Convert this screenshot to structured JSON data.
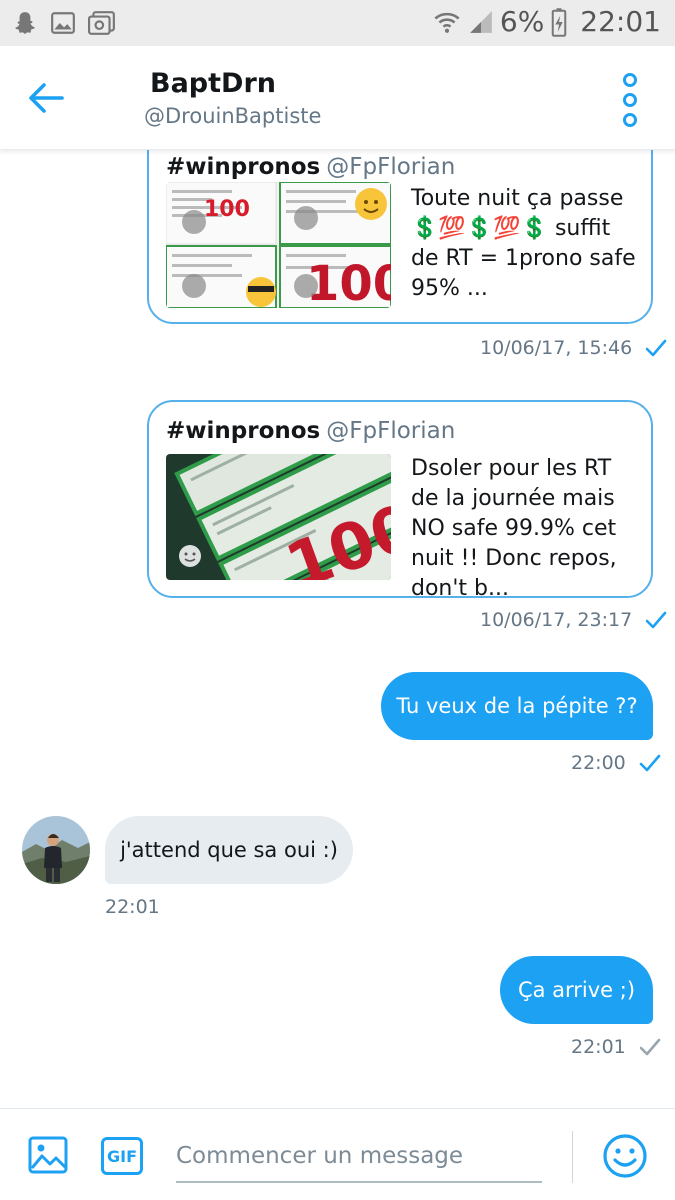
{
  "statusbar": {
    "battery": "6%",
    "time": "22:01"
  },
  "header": {
    "name": "BaptDrn",
    "handle": "@DrouinBaptiste"
  },
  "messages": [
    {
      "type": "tweet_card",
      "hashtag": "#winpronos",
      "user": "@FpFlorian",
      "text": "Toute nuit ça passe 💲💯💲💯💲 suffit de RT = 1prono safe 95% ...",
      "timestamp": "10/06/17, 15:46",
      "sent": true
    },
    {
      "type": "tweet_card",
      "hashtag": "#winpronos",
      "user": "@FpFlorian",
      "text": "Dsoler pour les RT de la journée mais NO safe 99.9%  cet nuit !! Donc repos, don't b...",
      "timestamp": "10/06/17, 23:17",
      "sent": true
    },
    {
      "type": "outgoing",
      "text": "Tu veux de la pépite ??",
      "timestamp": "22:00",
      "read": true
    },
    {
      "type": "incoming",
      "text": "j'attend que sa oui :)",
      "timestamp": "22:01"
    },
    {
      "type": "outgoing",
      "text": "Ça arrive ;)",
      "timestamp": "22:01",
      "read": false
    }
  ],
  "composer": {
    "gif_label": "GIF",
    "placeholder": "Commencer un message"
  },
  "icons": {
    "back": "arrow-left-icon",
    "more": "more-vertical-icon",
    "image": "image-icon",
    "emoji": "smiley-icon",
    "check": "checkmark-icon"
  },
  "colors": {
    "accent": "#1da1f2",
    "bubble_in": "#e6ecf0",
    "card_border": "#55b0ec",
    "muted": "#657786"
  }
}
